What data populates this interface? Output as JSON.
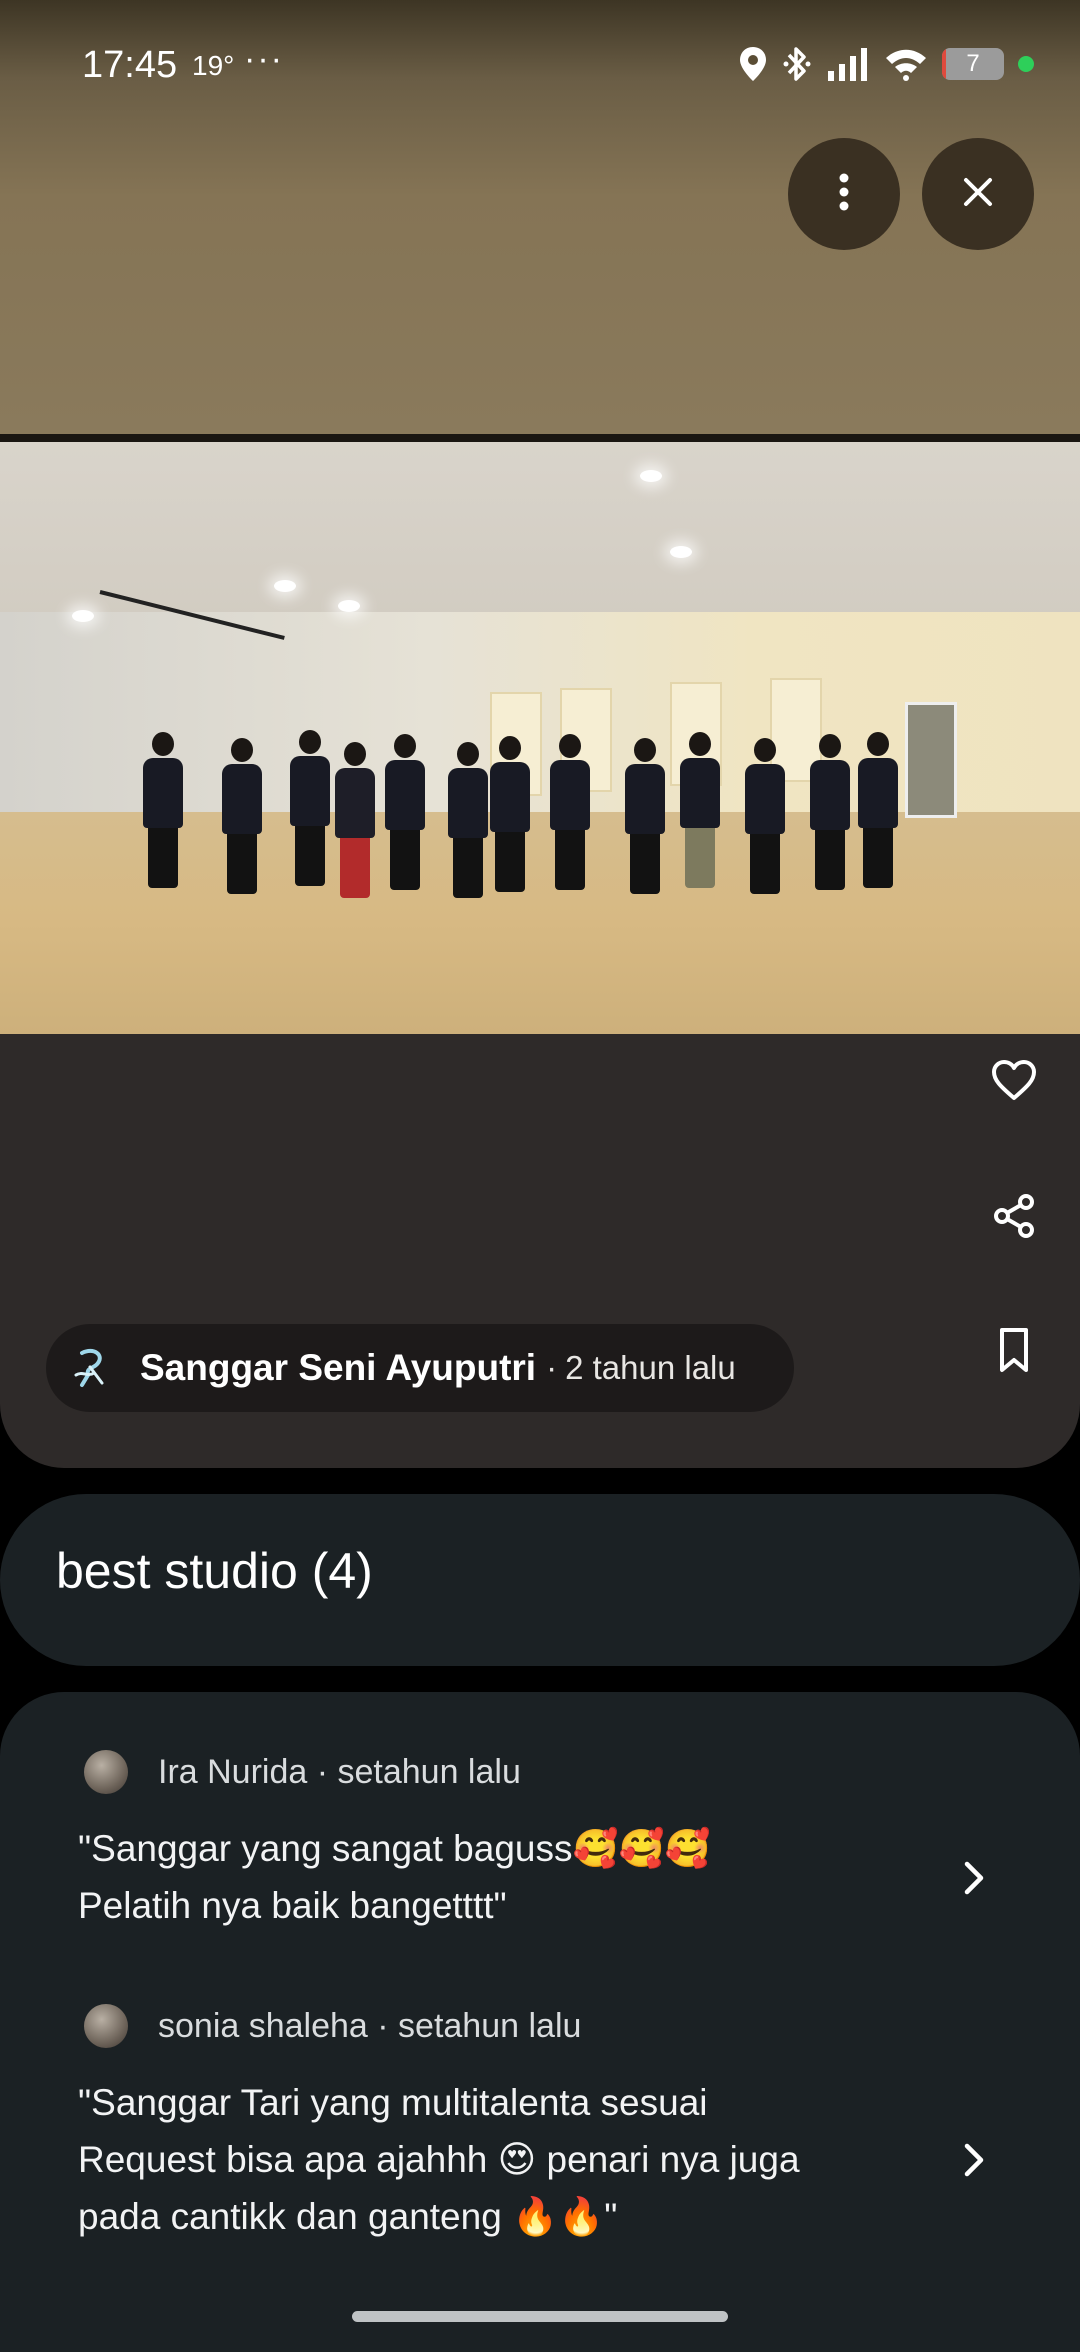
{
  "status_bar": {
    "time": "17:45",
    "temperature": "19°",
    "more_indicator": "···",
    "battery_level": "7",
    "battery_fraction": 0.07,
    "icons": [
      "location-icon",
      "bluetooth-icon",
      "signal-icon",
      "wifi-icon",
      "battery-icon",
      "privacy-dot-icon"
    ]
  },
  "viewer": {
    "more_icon": "more-vert-icon",
    "close_icon": "close-icon",
    "actions": [
      "heart-icon",
      "share-icon",
      "bookmark-icon"
    ],
    "owner": {
      "name": "Sanggar Seni Ayuputri",
      "separator": "·",
      "posted": "2 tahun lalu"
    }
  },
  "album": {
    "title": "best studio (4)"
  },
  "reviews": [
    {
      "author": "Ira Nurida",
      "separator": "·",
      "posted": "setahun lalu",
      "author_line": "Ira Nurida · setahun lalu",
      "text": "\"Sanggar yang sangat baguss🥰🥰🥰\nPelatih nya baik bangetttt\""
    },
    {
      "author": "sonia shaleha",
      "separator": "·",
      "posted": "setahun lalu",
      "author_line": "sonia shaleha · setahun lalu",
      "text": "\"Sanggar Tari yang multitalenta sesuai\nRequest bisa apa ajahhh 😍 penari nya juga\npada cantikk dan ganteng 🔥🔥\""
    }
  ],
  "colors": {
    "viewer_bg": "#2e2a29",
    "card_bg": "#1b2124",
    "chip_bg": "#1d1a1a",
    "top_button_bg": "#3a3022"
  }
}
